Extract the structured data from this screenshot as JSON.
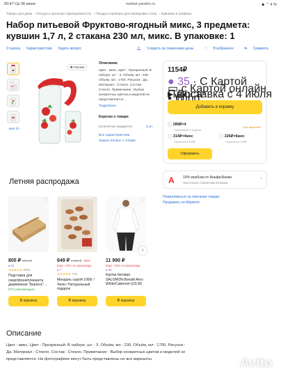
{
  "status": {
    "time": "00:47",
    "date": "Ср 28 июня",
    "url": "market.yandex.ru",
    "battery": "4 %"
  },
  "breadcrumb": [
    "Товары для дома",
    "Посуда и кухонные принадлежности",
    "Посуда и приборы для сервировки стола",
    "Кувшины и графины"
  ],
  "product": {
    "title": "Набор питьевой Фруктово-ягодный микс, 3 предмета: кувшин 1,7 л, 2 стакана 230 мл, микс. В упаковке: 1",
    "meta": [
      "0 оценок",
      "Характеристики",
      "Задать вопрос"
    ],
    "actions": [
      "Следить за снижением цены",
      "В избранное",
      "Сравнить"
    ],
    "like_badge": "Похоже",
    "thumbs_more": "ещё 10"
  },
  "description_col": {
    "heading": "Описание",
    "text": "Цвет : микс. Цвет : Прозрачный. В наборе, шт. : 3. Объём, мл : 230. Объём, мл : 1700. Рисунок : Да. Материал : Стекло. Состав : Стекло. Примечание : Выбор конкретных цветов и моделей не представляется...",
    "more_link": "Подробнее",
    "short_heading": "Коротко о товаре",
    "qty_label": "Количество предметов",
    "qty_value": "3 шт.",
    "all_chars": "Все характеристики",
    "ask": "Задать вопрос о товаре"
  },
  "buy": {
    "price": "1154₽",
    "promo": "35",
    "card_label": "С Картой Плюса",
    "card_price_note": "с Картой онлайн",
    "delivery": "Доставка с 4 июля",
    "delivery_extra": "+2",
    "seller": "Wind",
    "cart_button": "Добавить в корзину",
    "split_price": "289₽×4",
    "split_note": "Платёжный 2 недели",
    "no_overpay": "Без переплат",
    "opt1_price": "314₽×4мес",
    "opt1_note": "Переплата 359₽",
    "opt2_price": "226₽×6мес",
    "opt2_note": "Переплата 199₽",
    "order_button": "Оформить"
  },
  "alfa": {
    "text": "10% кешбэка от Альфа-Банка",
    "sub": "При оплате любой картой банка"
  },
  "links": [
    "Пожаловаться на описание товара",
    "Продавать на Маркете"
  ],
  "sale": {
    "title": "Летняя распродажа",
    "cards": [
      {
        "price": "805 ₽",
        "old": "8644 ₽",
        "ins": "21",
        "rating": "8963",
        "name": "Подставка для смартфона/планшета деревянная \"Бергенс\"...",
        "hl": "97% рекомендуют",
        "button": "В корзину"
      },
      {
        "price": "649 ₽",
        "old": "1 450 ₽",
        "disc": "-55%",
        "promo": "Ещё −10% по промокоду",
        "ins": "7",
        "rating": "793",
        "name": "Миндаль сырой 1000г / Чили / Натуральный подарок",
        "button": "В корзину"
      },
      {
        "price": "11 990 ₽",
        "promo": "Ещё −10% по промокоду",
        "ins": "36",
        "name": "Куртка беговая SALOMON Bonatti Aero White/Cabernet (US M)",
        "button": "В корзину"
      }
    ]
  },
  "full_description": {
    "title": "Описание",
    "text": "Цвет : микс. Цвет : Прозрачный. В наборе, шт. : 3. Объём, мл : 230. Объём, мл : 1700. Рисунок : Да. Материал : Стекло. Состав : Стекло. Примечание : Выбор конкретных цветов и моделей не представляется. На фотографиях могут быть представлены не все варианты"
  },
  "watermark": "Avito",
  "colors": {
    "accent": "#fed42b",
    "link": "#2a6ed4",
    "alfa_red": "#ef3124"
  }
}
